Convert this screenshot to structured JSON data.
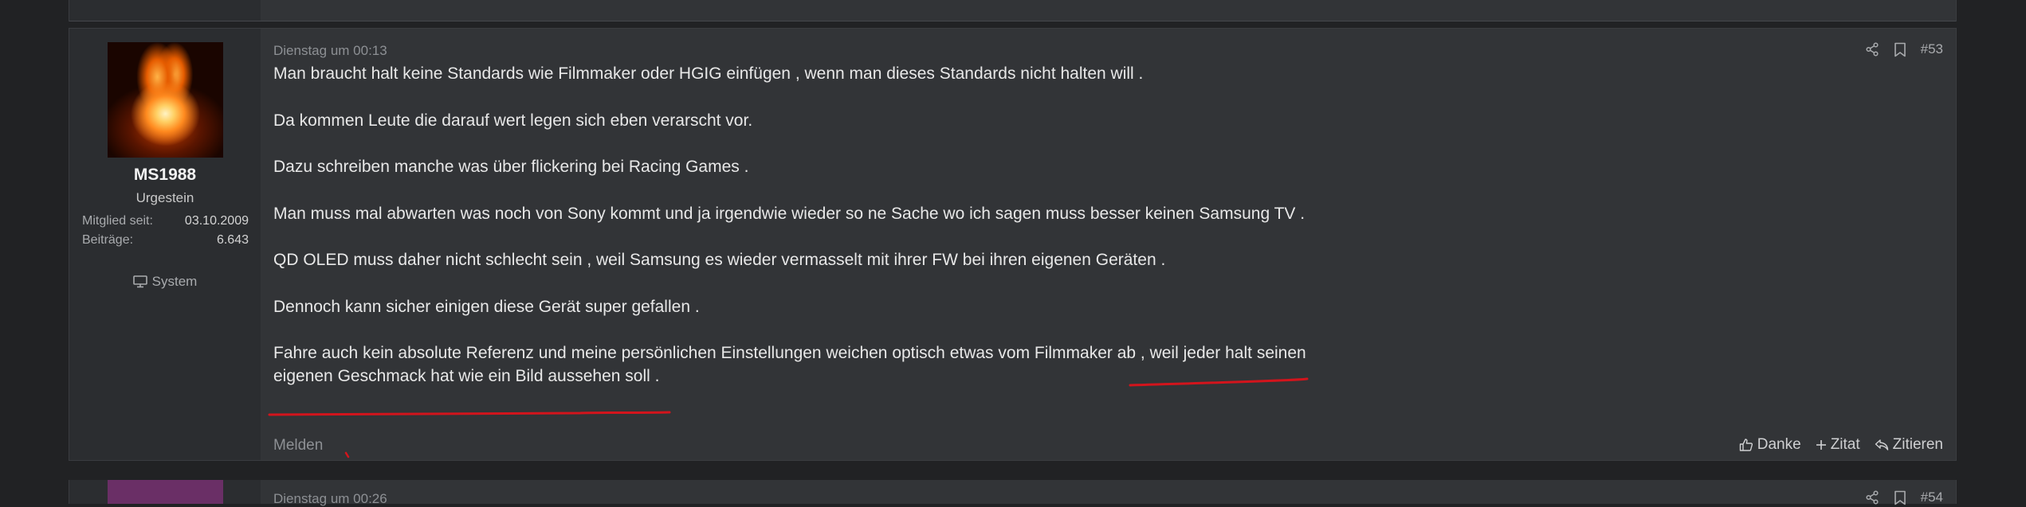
{
  "posts": {
    "post53": {
      "date": "Dienstag um 00:13",
      "number": "#53",
      "user": {
        "name": "MS1988",
        "title": "Urgestein",
        "joined_label": "Mitglied seit:",
        "joined_value": "03.10.2009",
        "posts_label": "Beiträge:",
        "posts_value": "6.643",
        "system_label": "System"
      },
      "paragraphs": [
        "Man braucht halt keine Standards wie Filmmaker oder HGIG einfügen , wenn man dieses Standards nicht halten will .",
        "Da kommen Leute die darauf wert legen sich eben verarscht vor.",
        "Dazu schreiben manche was über flickering bei Racing Games .",
        "Man muss mal abwarten was noch von Sony kommt und ja irgendwie wieder so ne Sache wo ich sagen muss besser keinen Samsung TV .",
        "QD OLED muss daher nicht schlecht sein , weil Samsung es wieder vermasselt mit ihrer FW bei ihren eigenen Geräten .",
        "Dennoch kann sicher einigen diese Gerät super gefallen .",
        "Fahre auch kein absolute Referenz und meine persönlichen Einstellungen weichen optisch etwas vom Filmmaker ab , weil jeder halt seinen eigenen Geschmack hat wie ein Bild aussehen soll ."
      ],
      "report_label": "Melden",
      "like_label": "Danke",
      "quote_label": "Zitat",
      "reply_label": "Zitieren"
    },
    "post54": {
      "date": "Dienstag um 00:26",
      "number": "#54"
    }
  },
  "icons": {
    "share": "share-icon",
    "bookmark": "bookmark-icon",
    "system": "monitor-icon",
    "like": "thumbs-up-icon",
    "quote": "plus-icon",
    "reply": "reply-icon"
  },
  "colors": {
    "page_bg": "#212224",
    "post_bg": "#323437",
    "user_bg": "#2b2d30",
    "annotation_red": "#d3141c"
  }
}
